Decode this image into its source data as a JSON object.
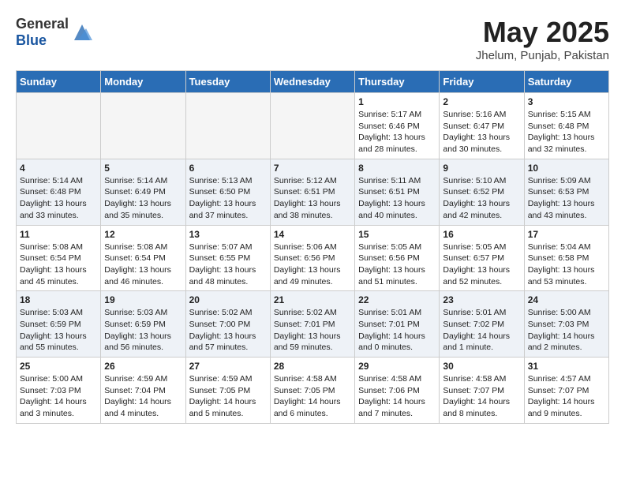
{
  "header": {
    "logo_general": "General",
    "logo_blue": "Blue",
    "month_title": "May 2025",
    "location": "Jhelum, Punjab, Pakistan"
  },
  "weekdays": [
    "Sunday",
    "Monday",
    "Tuesday",
    "Wednesday",
    "Thursday",
    "Friday",
    "Saturday"
  ],
  "weeks": [
    [
      {
        "day": "",
        "info": ""
      },
      {
        "day": "",
        "info": ""
      },
      {
        "day": "",
        "info": ""
      },
      {
        "day": "",
        "info": ""
      },
      {
        "day": "1",
        "info": "Sunrise: 5:17 AM\nSunset: 6:46 PM\nDaylight: 13 hours\nand 28 minutes."
      },
      {
        "day": "2",
        "info": "Sunrise: 5:16 AM\nSunset: 6:47 PM\nDaylight: 13 hours\nand 30 minutes."
      },
      {
        "day": "3",
        "info": "Sunrise: 5:15 AM\nSunset: 6:48 PM\nDaylight: 13 hours\nand 32 minutes."
      }
    ],
    [
      {
        "day": "4",
        "info": "Sunrise: 5:14 AM\nSunset: 6:48 PM\nDaylight: 13 hours\nand 33 minutes."
      },
      {
        "day": "5",
        "info": "Sunrise: 5:14 AM\nSunset: 6:49 PM\nDaylight: 13 hours\nand 35 minutes."
      },
      {
        "day": "6",
        "info": "Sunrise: 5:13 AM\nSunset: 6:50 PM\nDaylight: 13 hours\nand 37 minutes."
      },
      {
        "day": "7",
        "info": "Sunrise: 5:12 AM\nSunset: 6:51 PM\nDaylight: 13 hours\nand 38 minutes."
      },
      {
        "day": "8",
        "info": "Sunrise: 5:11 AM\nSunset: 6:51 PM\nDaylight: 13 hours\nand 40 minutes."
      },
      {
        "day": "9",
        "info": "Sunrise: 5:10 AM\nSunset: 6:52 PM\nDaylight: 13 hours\nand 42 minutes."
      },
      {
        "day": "10",
        "info": "Sunrise: 5:09 AM\nSunset: 6:53 PM\nDaylight: 13 hours\nand 43 minutes."
      }
    ],
    [
      {
        "day": "11",
        "info": "Sunrise: 5:08 AM\nSunset: 6:54 PM\nDaylight: 13 hours\nand 45 minutes."
      },
      {
        "day": "12",
        "info": "Sunrise: 5:08 AM\nSunset: 6:54 PM\nDaylight: 13 hours\nand 46 minutes."
      },
      {
        "day": "13",
        "info": "Sunrise: 5:07 AM\nSunset: 6:55 PM\nDaylight: 13 hours\nand 48 minutes."
      },
      {
        "day": "14",
        "info": "Sunrise: 5:06 AM\nSunset: 6:56 PM\nDaylight: 13 hours\nand 49 minutes."
      },
      {
        "day": "15",
        "info": "Sunrise: 5:05 AM\nSunset: 6:56 PM\nDaylight: 13 hours\nand 51 minutes."
      },
      {
        "day": "16",
        "info": "Sunrise: 5:05 AM\nSunset: 6:57 PM\nDaylight: 13 hours\nand 52 minutes."
      },
      {
        "day": "17",
        "info": "Sunrise: 5:04 AM\nSunset: 6:58 PM\nDaylight: 13 hours\nand 53 minutes."
      }
    ],
    [
      {
        "day": "18",
        "info": "Sunrise: 5:03 AM\nSunset: 6:59 PM\nDaylight: 13 hours\nand 55 minutes."
      },
      {
        "day": "19",
        "info": "Sunrise: 5:03 AM\nSunset: 6:59 PM\nDaylight: 13 hours\nand 56 minutes."
      },
      {
        "day": "20",
        "info": "Sunrise: 5:02 AM\nSunset: 7:00 PM\nDaylight: 13 hours\nand 57 minutes."
      },
      {
        "day": "21",
        "info": "Sunrise: 5:02 AM\nSunset: 7:01 PM\nDaylight: 13 hours\nand 59 minutes."
      },
      {
        "day": "22",
        "info": "Sunrise: 5:01 AM\nSunset: 7:01 PM\nDaylight: 14 hours\nand 0 minutes."
      },
      {
        "day": "23",
        "info": "Sunrise: 5:01 AM\nSunset: 7:02 PM\nDaylight: 14 hours\nand 1 minute."
      },
      {
        "day": "24",
        "info": "Sunrise: 5:00 AM\nSunset: 7:03 PM\nDaylight: 14 hours\nand 2 minutes."
      }
    ],
    [
      {
        "day": "25",
        "info": "Sunrise: 5:00 AM\nSunset: 7:03 PM\nDaylight: 14 hours\nand 3 minutes."
      },
      {
        "day": "26",
        "info": "Sunrise: 4:59 AM\nSunset: 7:04 PM\nDaylight: 14 hours\nand 4 minutes."
      },
      {
        "day": "27",
        "info": "Sunrise: 4:59 AM\nSunset: 7:05 PM\nDaylight: 14 hours\nand 5 minutes."
      },
      {
        "day": "28",
        "info": "Sunrise: 4:58 AM\nSunset: 7:05 PM\nDaylight: 14 hours\nand 6 minutes."
      },
      {
        "day": "29",
        "info": "Sunrise: 4:58 AM\nSunset: 7:06 PM\nDaylight: 14 hours\nand 7 minutes."
      },
      {
        "day": "30",
        "info": "Sunrise: 4:58 AM\nSunset: 7:07 PM\nDaylight: 14 hours\nand 8 minutes."
      },
      {
        "day": "31",
        "info": "Sunrise: 4:57 AM\nSunset: 7:07 PM\nDaylight: 14 hours\nand 9 minutes."
      }
    ]
  ]
}
